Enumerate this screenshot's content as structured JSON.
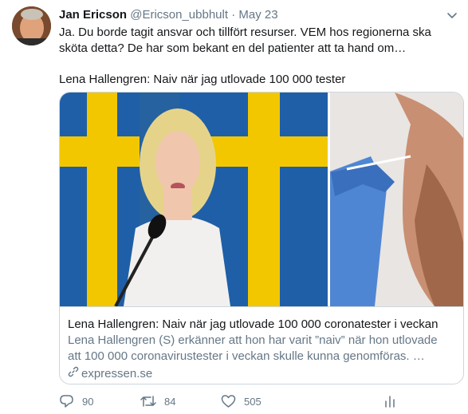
{
  "tweet": {
    "author_name": "Jan Ericson",
    "author_handle": "@Ericson_ubbhult",
    "separator": "·",
    "date": "May 23",
    "text": "Ja. Du borde tagit ansvar och tillfört resurser. VEM hos regionerna ska sköta detta? De har som bekant en del patienter att ta hand om…",
    "quote": "Lena Hallengren: Naiv när jag utlovade 100 000 tester",
    "icons": {
      "menu": "chevron-down-icon",
      "link": "link-icon"
    }
  },
  "card": {
    "title": "Lena Hallengren: Naiv när jag utlovade 100 000 coronatester i veckan",
    "description": "Lena Hallengren (S) erkänner att hon har varit ”naiv” när hon utlovade att 100 000 coronavirustester i veckan skulle kunna genomföras. …",
    "source": "expressen.se"
  },
  "actions": {
    "replies": "90",
    "retweets": "84",
    "likes": "505",
    "icons": [
      "reply-icon",
      "retweet-icon",
      "like-icon",
      "analytics-icon"
    ]
  },
  "colors": {
    "text": "#14171a",
    "muted": "#657786",
    "border": "#ccd6dd",
    "flag_blue": "#1f5fa8",
    "flag_yellow": "#f2c700",
    "glove_blue": "#4f86d4"
  }
}
